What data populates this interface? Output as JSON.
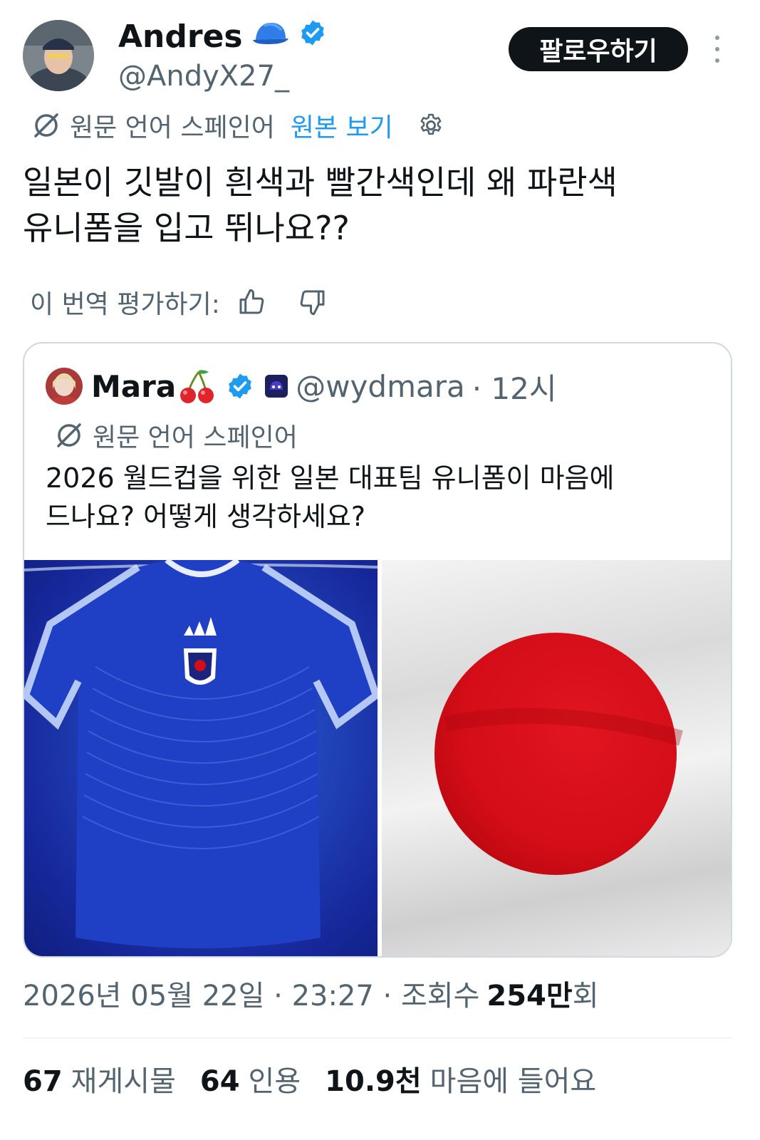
{
  "author": {
    "name": "Andres",
    "handle": "@AndyX27_"
  },
  "follow_label": "팔로우하기",
  "translation": {
    "source_note": "원문 언어 스페인어",
    "show_original": "원본 보기"
  },
  "tweet": {
    "line1": "일본이 깃발이 흰색과 빨간색인데 왜 파란색",
    "line2": "유니폼을 입고 뛰나요??"
  },
  "rate_translation_label": "이 번역 평가하기:",
  "quote": {
    "name": "Mara",
    "handle": "@wydmara",
    "time": "· 12시",
    "source_note": "원문 언어 스페인어",
    "line1": "2026 월드컵을 위한 일본 대표팀 유니폼이 마음에",
    "line2": "드나요? 어떻게 생각하세요?"
  },
  "meta": {
    "timestamp": "2026년 05월 22일 · 23:27 · 조회수",
    "views_count": "254만",
    "views_suffix": "회"
  },
  "stats": [
    {
      "count": "67",
      "label": "재게시물"
    },
    {
      "count": "64",
      "label": "인용"
    },
    {
      "count": "10.9천",
      "label": "마음에 들어요"
    }
  ],
  "colors": {
    "text": "#0f1419",
    "secondary": "#536471",
    "link": "#1d9bf0",
    "verified": "#1d9bf0",
    "border": "#cfd9de",
    "flag_red": "#d40d18"
  }
}
